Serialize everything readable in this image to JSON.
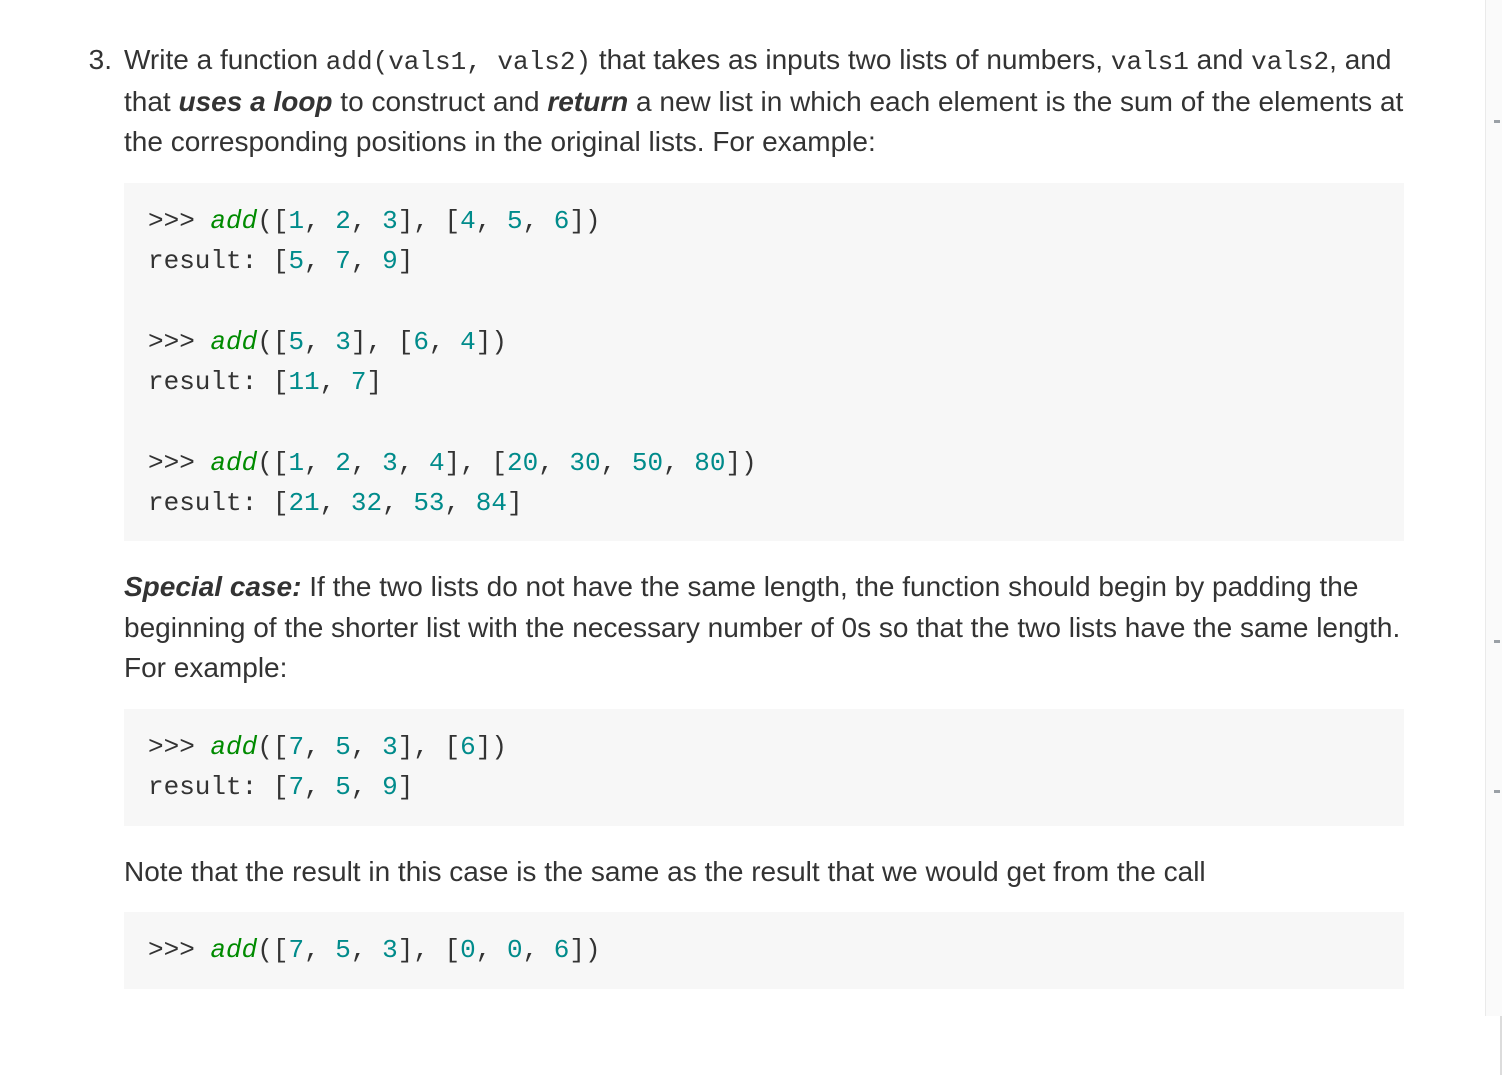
{
  "problem": {
    "number": "3.",
    "intro": {
      "pre": "Write a function ",
      "sig": "add(vals1, vals2)",
      "post1": " that takes as inputs two lists of numbers, ",
      "v1": "vals1",
      "post2": " and ",
      "v2": "vals2",
      "post3": ", and that ",
      "loop": "uses a loop",
      "post4": " to construct and ",
      "ret": "return",
      "post5": " a new list in which each element is the sum of the elements at the corresponding positions in the original lists. For example:"
    },
    "code1": {
      "prompt": ">>>",
      "fn": "add",
      "l1_call_open": "([",
      "l1_a": "1",
      "sep": ", ",
      "l1_b": "2",
      "l1_c": "3",
      "mid": "], [",
      "l1_d": "4",
      "l1_e": "5",
      "l1_f": "6",
      "close": "])",
      "res_label": "result:",
      "l1_res_open": " [",
      "l1_r1": "5",
      "l1_r2": "7",
      "l1_r3": "9",
      "res_close": "]",
      "l2_a": "5",
      "l2_b": "3",
      "l2_c": "6",
      "l2_d": "4",
      "l2_r1": "11",
      "l2_r2": "7",
      "l3_a": "1",
      "l3_b": "2",
      "l3_c": "3",
      "l3_d": "4",
      "l3_e": "20",
      "l3_f": "30",
      "l3_g": "50",
      "l3_h": "80",
      "l3_r1": "21",
      "l3_r2": "32",
      "l3_r3": "53",
      "l3_r4": "84"
    },
    "special": {
      "label": "Special case:",
      "text": " If the two lists do not have the same length, the function should begin by padding the beginning of the shorter list with the necessary number of 0s so that the two lists have the same length. For example:"
    },
    "code2": {
      "prompt": ">>>",
      "fn": "add",
      "open": "([",
      "a": "7",
      "sep": ", ",
      "b": "5",
      "c": "3",
      "mid": "], [",
      "d": "6",
      "close": "])",
      "res_label": "result:",
      "res_open": " [",
      "r1": "7",
      "r2": "5",
      "r3": "9",
      "res_close": "]"
    },
    "note": "Note that the result in this case is the same as the result that we would get from the call",
    "code3": {
      "prompt": ">>>",
      "fn": "add",
      "open": "([",
      "a": "7",
      "sep": ", ",
      "b": "5",
      "c": "3",
      "mid": "], [",
      "d": "0",
      "e": "0",
      "f": "6",
      "close": "])"
    }
  }
}
